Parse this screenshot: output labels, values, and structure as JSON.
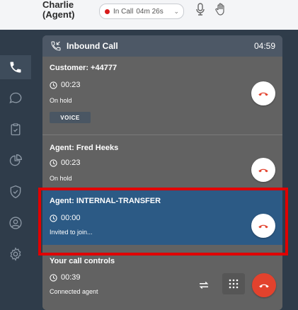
{
  "header": {
    "agent_name": "Charlie (Agent)",
    "status_label": "In Call",
    "status_time": "04m 26s",
    "status_color": "#d81b1b"
  },
  "panel": {
    "title": "Inbound Call",
    "timer": "04:59"
  },
  "calls": [
    {
      "label": "Customer: +44777",
      "time": "00:23",
      "state": "On hold",
      "badge": "VOICE"
    },
    {
      "label": "Agent: Fred Heeks",
      "time": "00:23",
      "state": "On hold"
    },
    {
      "label": "Agent: INTERNAL-TRANSFER",
      "time": "00:00",
      "state": "Invited to join..."
    }
  ],
  "controls": {
    "label": "Your call controls",
    "time": "00:39",
    "state": "Connected agent"
  },
  "colors": {
    "selected_card": "#2c5a85",
    "highlight": "#e00000",
    "hangup_red": "#e3422d"
  },
  "sidebar_icons": [
    "phone-icon",
    "chat-icon",
    "clipboard-icon",
    "pie-chart-icon",
    "shield-icon",
    "user-icon",
    "gear-icon"
  ]
}
